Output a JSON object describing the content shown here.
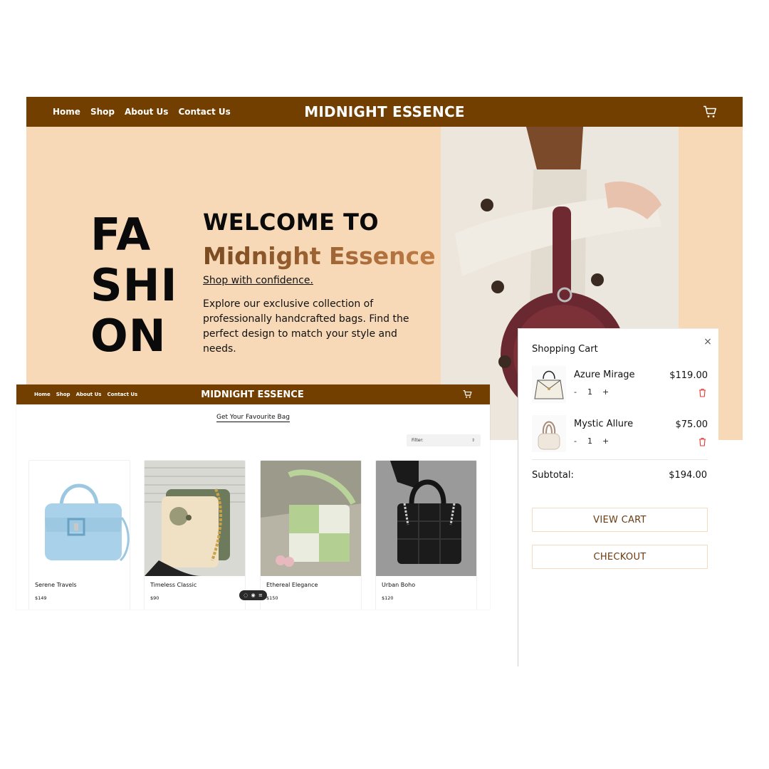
{
  "colors": {
    "nav_brown": "#733f00",
    "hero_bg": "#f7d9b7",
    "trash_red": "#e53935"
  },
  "hero": {
    "nav": {
      "links": [
        "Home",
        "Shop",
        "About Us",
        "Contact Us"
      ],
      "brand": "MIDNIGHT ESSENCE",
      "cart_icon": "cart-icon"
    },
    "fashion_lines": [
      "FA",
      "SHI",
      "ON"
    ],
    "welcome": "WELCOME TO",
    "brand_name": "Midnight Essence",
    "tagline": "Shop with confidence.",
    "description": "Explore our exclusive collection of professionally handcrafted bags. Find the perfect design to match your style and needs."
  },
  "shop": {
    "nav": {
      "links": [
        "Home",
        "Shop",
        "About Us",
        "Contact Us"
      ],
      "brand": "MIDNIGHT ESSENCE"
    },
    "section_title": "Get Your Favourite Bag",
    "filter_label": "Filter:",
    "products": [
      {
        "name": "Serene Travels",
        "price": "$149"
      },
      {
        "name": "Timeless Classic",
        "price": "$90"
      },
      {
        "name": "Ethereal Elegance",
        "price": "$150"
      },
      {
        "name": "Urban Boho",
        "price": "$120"
      }
    ]
  },
  "cart": {
    "title": "Shopping Cart",
    "close": "×",
    "items": [
      {
        "name": "Azure Mirage",
        "price": "$119.00",
        "qty": "1",
        "minus": "-",
        "plus": "+"
      },
      {
        "name": "Mystic Allure",
        "price": "$75.00",
        "qty": "1",
        "minus": "-",
        "plus": "+"
      }
    ],
    "subtotal_label": "Subtotal:",
    "subtotal_value": "$194.00",
    "view_cart": "VIEW CART",
    "checkout": "CHECKOUT"
  }
}
